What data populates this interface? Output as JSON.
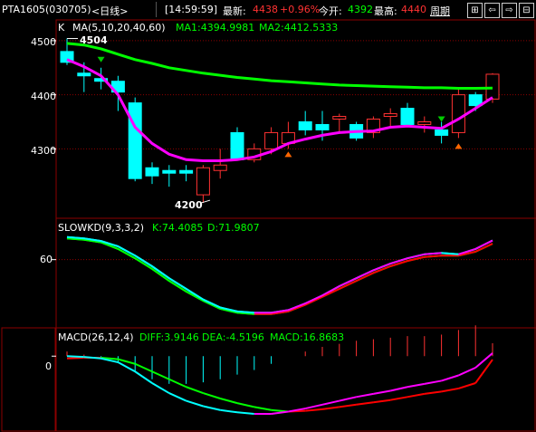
{
  "header": {
    "symbol": "PTA1605(030705)",
    "period": "<日线>",
    "time": "[14:59:59]",
    "latest_label": "最新:",
    "latest_value": "4438",
    "change": "+0.96%",
    "open_label": "今开:",
    "open_value": "4392",
    "high_label": "最高:",
    "high_value": "4440",
    "cycle_label": "周期"
  },
  "colors": {
    "up": "#ff3232",
    "down": "#00ffff",
    "ma1": "#ff00ff",
    "ma2": "#00ff00",
    "k": "#00ffff",
    "d": "#ff00ff",
    "grid": "#8b0000",
    "gold": "#ffff00"
  },
  "chart_data": [
    {
      "type": "candlestick",
      "title": "K",
      "ma_label": "MA(5,10,20,40,60)",
      "ma1_label": "MA1:4394.9981",
      "ma2_label": "MA2:4412.5333",
      "y_ticks": [
        "4500",
        "4400",
        "4300"
      ],
      "ylim": [
        4180,
        4525
      ],
      "high_marker": "4504",
      "low_marker": "4200",
      "candles": [
        {
          "o": 4480,
          "h": 4504,
          "l": 4455,
          "c": 4460
        },
        {
          "o": 4440,
          "h": 4460,
          "l": 4405,
          "c": 4435
        },
        {
          "o": 4430,
          "h": 4450,
          "l": 4410,
          "c": 4425
        },
        {
          "o": 4425,
          "h": 4435,
          "l": 4370,
          "c": 4405
        },
        {
          "o": 4385,
          "h": 4395,
          "l": 4240,
          "c": 4245
        },
        {
          "o": 4265,
          "h": 4275,
          "l": 4235,
          "c": 4250
        },
        {
          "o": 4260,
          "h": 4270,
          "l": 4230,
          "c": 4255
        },
        {
          "o": 4260,
          "h": 4270,
          "l": 4240,
          "c": 4255
        },
        {
          "o": 4215,
          "h": 4270,
          "l": 4200,
          "c": 4265
        },
        {
          "o": 4260,
          "h": 4300,
          "l": 4245,
          "c": 4270
        },
        {
          "o": 4330,
          "h": 4340,
          "l": 4280,
          "c": 4280
        },
        {
          "o": 4280,
          "h": 4310,
          "l": 4275,
          "c": 4300
        },
        {
          "o": 4300,
          "h": 4340,
          "l": 4290,
          "c": 4330
        },
        {
          "o": 4310,
          "h": 4350,
          "l": 4300,
          "c": 4330
        },
        {
          "o": 4350,
          "h": 4370,
          "l": 4325,
          "c": 4335
        },
        {
          "o": 4345,
          "h": 4370,
          "l": 4315,
          "c": 4335
        },
        {
          "o": 4355,
          "h": 4365,
          "l": 4330,
          "c": 4360
        },
        {
          "o": 4345,
          "h": 4350,
          "l": 4315,
          "c": 4320
        },
        {
          "o": 4330,
          "h": 4360,
          "l": 4320,
          "c": 4355
        },
        {
          "o": 4360,
          "h": 4375,
          "l": 4340,
          "c": 4365
        },
        {
          "o": 4375,
          "h": 4385,
          "l": 4340,
          "c": 4345
        },
        {
          "o": 4345,
          "h": 4360,
          "l": 4330,
          "c": 4350
        },
        {
          "o": 4335,
          "h": 4350,
          "l": 4310,
          "c": 4325
        },
        {
          "o": 4330,
          "h": 4410,
          "l": 4320,
          "c": 4400
        },
        {
          "o": 4400,
          "h": 4405,
          "l": 4370,
          "c": 4380
        },
        {
          "o": 4392,
          "h": 4440,
          "l": 4385,
          "c": 4438
        }
      ],
      "ma1": [
        4465,
        4452,
        4435,
        4400,
        4340,
        4310,
        4290,
        4280,
        4278,
        4278,
        4280,
        4285,
        4295,
        4310,
        4318,
        4325,
        4330,
        4332,
        4333,
        4340,
        4342,
        4340,
        4338,
        4355,
        4375,
        4395
      ],
      "ma2": [
        4495,
        4492,
        4485,
        4475,
        4465,
        4458,
        4450,
        4445,
        4440,
        4436,
        4432,
        4429,
        4426,
        4424,
        4422,
        4420,
        4418,
        4417,
        4416,
        4415,
        4414,
        4413,
        4413,
        4412,
        4412,
        4412.5
      ]
    },
    {
      "type": "line",
      "title": "SLOWKD(9,3,3,2)",
      "k_label": "K:74.4085",
      "d_label": "D:71.9807",
      "y_ticks": [
        "60"
      ],
      "ylim": [
        10,
        85
      ],
      "series": [
        {
          "name": "K",
          "values": [
            77,
            76,
            74,
            70,
            63,
            55,
            46,
            38,
            30,
            24,
            21,
            20,
            20,
            22,
            27,
            33,
            40,
            46,
            52,
            57,
            61,
            64,
            65,
            64,
            68,
            74.4
          ]
        },
        {
          "name": "D",
          "values": [
            76,
            75,
            73,
            68,
            61,
            53,
            44,
            36,
            29,
            23,
            20,
            19,
            19,
            21,
            26,
            32,
            38,
            44,
            50,
            55,
            59,
            62,
            63,
            63,
            66,
            72.0
          ]
        }
      ]
    },
    {
      "type": "line",
      "title": "MACD(26,12,4)",
      "diff_label": "DIFF:3.9146",
      "dea_label": "DEA:-4.5196",
      "macd_label": "MACD:16.8683",
      "y_ticks": [
        "0"
      ],
      "ylim": [
        -95,
        25
      ],
      "series": [
        {
          "name": "DIFF",
          "values": [
            0,
            -1,
            -3,
            -8,
            -20,
            -35,
            -48,
            -58,
            -65,
            -70,
            -73,
            -75,
            -75,
            -72,
            -68,
            -63,
            -58,
            -53,
            -49,
            -45,
            -40,
            -36,
            -32,
            -25,
            -15,
            3.9
          ]
        },
        {
          "name": "DEA",
          "values": [
            -3,
            -2,
            -2,
            -4,
            -10,
            -20,
            -30,
            -40,
            -48,
            -55,
            -61,
            -66,
            -70,
            -72,
            -71,
            -69,
            -66,
            -63,
            -60,
            -57,
            -53,
            -49,
            -46,
            -42,
            -35,
            -4.5
          ]
        }
      ]
    }
  ]
}
